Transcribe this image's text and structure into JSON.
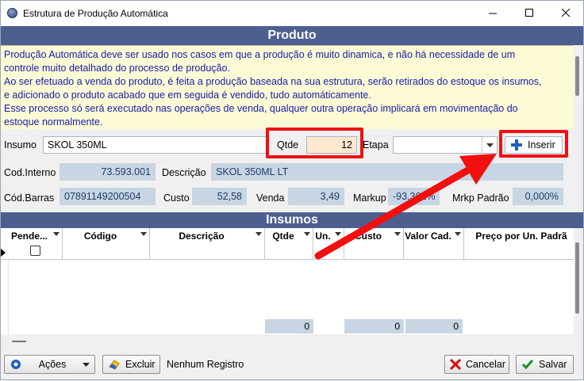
{
  "window": {
    "title": "Estrutura de Produção Automática"
  },
  "produto": {
    "header": "Produto",
    "info_lines": [
      "Produção Automática deve ser usado nos casos em que a produção é muito dinamica, e não há necessidade de um",
      "controle muito detalhado do processo de produção.",
      "Ao ser efetuado a venda do produto, é feita a produção baseada na sua estrutura, serão retirados do estoque os insumos,",
      "e adicionado o produto acabado que em seguida é vendido, tudo automáticamente.",
      "Esse processo só será executado nas operações de venda, qualquer outra operação implicará em movimentação do",
      "estoque normalmente."
    ]
  },
  "form": {
    "insumo_label": "Insumo",
    "insumo_value": "SKOL 350ML",
    "qtde_label": "Qtde",
    "qtde_value": "12",
    "etapa_label": "Etapa",
    "etapa_value": "",
    "inserir_label": "Inserir",
    "cod_interno_label": "Cod.Interno",
    "cod_interno_value": "73.593.001",
    "descricao_label": "Descrição",
    "descricao_value": "SKOL 350ML LT",
    "cod_barras_label": "Cód.Barras",
    "cod_barras_value": "07891149200504",
    "custo_label": "Custo",
    "custo_value": "52,58",
    "venda_label": "Venda",
    "venda_value": "3,49",
    "markup_label": "Markup",
    "markup_value": "-93,362%",
    "mrkp_padrao_label": "Mrkp Padrão",
    "mrkp_padrao_value": "0,000%"
  },
  "insumos": {
    "header": "Insumos",
    "columns": [
      "Pende...",
      "Código",
      "Descrição",
      "Qtde",
      "Un.",
      "Custo",
      "Valor Cad.",
      "Preço por Un. Padrã"
    ],
    "totals": {
      "qtde": "0",
      "custo": "0",
      "valor_cad": "0"
    }
  },
  "footer": {
    "acoes_label": "Ações",
    "excluir_label": "Excluir",
    "status": "Nenhum Registro",
    "cancelar_label": "Cancelar",
    "salvar_label": "Salvar"
  },
  "colors": {
    "header_bar": "#4d5f8f",
    "info_bg": "#fcfbd5",
    "info_text": "#1a1aa8",
    "readonly_bg": "#c8d5e3",
    "highlight": "#f01010"
  }
}
